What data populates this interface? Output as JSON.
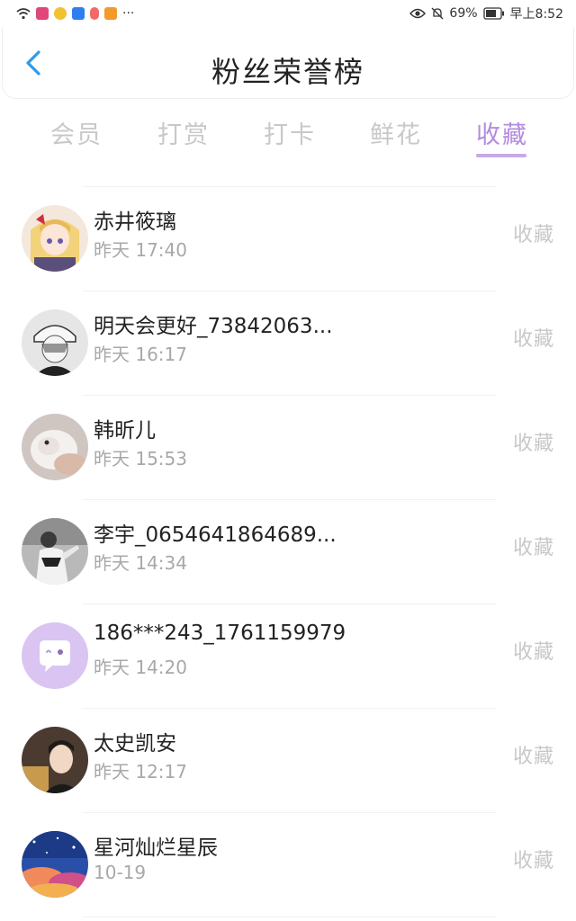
{
  "status_bar": {
    "battery": "69%",
    "time": "早上8:52",
    "more": "···"
  },
  "header": {
    "title": "粉丝荣誉榜"
  },
  "tabs": [
    {
      "label": "会员"
    },
    {
      "label": "打赏"
    },
    {
      "label": "打卡"
    },
    {
      "label": "鲜花"
    },
    {
      "label": "收藏",
      "active": true
    }
  ],
  "fans": [
    {
      "name": "赤井筱璃",
      "time": "昨天 17:40",
      "action": "收藏",
      "avatar": "anime-girl-avatar"
    },
    {
      "name": "明天会更好_73842063...",
      "time": "昨天 16:17",
      "action": "收藏",
      "avatar": "sketch-boy-avatar"
    },
    {
      "name": "韩昕儿",
      "time": "昨天 15:53",
      "action": "收藏",
      "avatar": "hamster-avatar"
    },
    {
      "name": "李宇_0654641864689...",
      "time": "昨天 14:34",
      "action": "收藏",
      "avatar": "person-photo-avatar"
    },
    {
      "name": "186***243_1761159979",
      "time": "昨天 14:20",
      "action": "收藏",
      "avatar": "chat-bubble-avatar"
    },
    {
      "name": "太史凯安",
      "time": "昨天 12:17",
      "action": "收藏",
      "avatar": "portrait-avatar"
    },
    {
      "name": "星河灿烂星辰",
      "time": "10-19",
      "action": "收藏",
      "avatar": "starry-sky-avatar"
    }
  ],
  "colors": {
    "accent": "#b38be0",
    "inactive_tab": "#c8c8c8",
    "time_text": "#a8a8a8",
    "back_arrow": "#2e9be6",
    "default_avatar_bg": "#d9c4f2"
  }
}
